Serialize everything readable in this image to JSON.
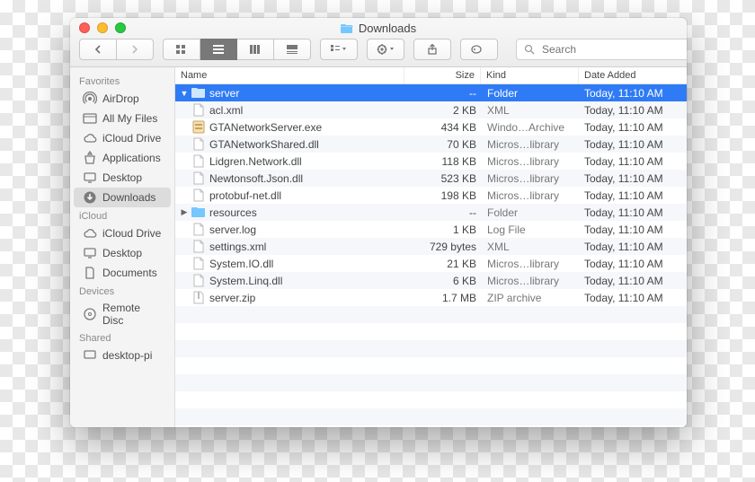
{
  "window": {
    "title": "Downloads"
  },
  "search": {
    "placeholder": "Search"
  },
  "sidebar": {
    "sections": [
      {
        "heading": "Favorites",
        "items": [
          {
            "icon": "airdrop",
            "label": "AirDrop"
          },
          {
            "icon": "allfiles",
            "label": "All My Files"
          },
          {
            "icon": "cloud",
            "label": "iCloud Drive"
          },
          {
            "icon": "apps",
            "label": "Applications"
          },
          {
            "icon": "desktop",
            "label": "Desktop"
          },
          {
            "icon": "downloads",
            "label": "Downloads",
            "selected": true
          }
        ]
      },
      {
        "heading": "iCloud",
        "items": [
          {
            "icon": "cloud",
            "label": "iCloud Drive"
          },
          {
            "icon": "desktop",
            "label": "Desktop"
          },
          {
            "icon": "docs",
            "label": "Documents"
          }
        ]
      },
      {
        "heading": "Devices",
        "items": [
          {
            "icon": "disc",
            "label": "Remote Disc"
          }
        ]
      },
      {
        "heading": "Shared",
        "items": [
          {
            "icon": "screen",
            "label": "desktop-pi"
          }
        ]
      }
    ]
  },
  "columns": {
    "name": "Name",
    "size": "Size",
    "kind": "Kind",
    "date": "Date Added"
  },
  "files": [
    {
      "level": 0,
      "disclosure": "down",
      "icon": "folder",
      "name": "server",
      "size": "--",
      "kind": "Folder",
      "date": "Today, 11:10 AM",
      "selected": true
    },
    {
      "level": 1,
      "icon": "file",
      "name": "acl.xml",
      "size": "2 KB",
      "kind": "XML",
      "date": "Today, 11:10 AM"
    },
    {
      "level": 1,
      "icon": "exe",
      "name": "GTANetworkServer.exe",
      "size": "434 KB",
      "kind": "Windo…Archive",
      "date": "Today, 11:10 AM"
    },
    {
      "level": 1,
      "icon": "file",
      "name": "GTANetworkShared.dll",
      "size": "70 KB",
      "kind": "Micros…library",
      "date": "Today, 11:10 AM"
    },
    {
      "level": 1,
      "icon": "file",
      "name": "Lidgren.Network.dll",
      "size": "118 KB",
      "kind": "Micros…library",
      "date": "Today, 11:10 AM"
    },
    {
      "level": 1,
      "icon": "file",
      "name": "Newtonsoft.Json.dll",
      "size": "523 KB",
      "kind": "Micros…library",
      "date": "Today, 11:10 AM"
    },
    {
      "level": 1,
      "icon": "file",
      "name": "protobuf-net.dll",
      "size": "198 KB",
      "kind": "Micros…library",
      "date": "Today, 11:10 AM"
    },
    {
      "level": 1,
      "disclosure": "right",
      "icon": "folder",
      "name": "resources",
      "size": "--",
      "kind": "Folder",
      "date": "Today, 11:10 AM"
    },
    {
      "level": 1,
      "icon": "file",
      "name": "server.log",
      "size": "1 KB",
      "kind": "Log File",
      "date": "Today, 11:10 AM"
    },
    {
      "level": 1,
      "icon": "file",
      "name": "settings.xml",
      "size": "729 bytes",
      "kind": "XML",
      "date": "Today, 11:10 AM"
    },
    {
      "level": 1,
      "icon": "file",
      "name": "System.IO.dll",
      "size": "21 KB",
      "kind": "Micros…library",
      "date": "Today, 11:10 AM"
    },
    {
      "level": 1,
      "icon": "file",
      "name": "System.Linq.dll",
      "size": "6 KB",
      "kind": "Micros…library",
      "date": "Today, 11:10 AM"
    },
    {
      "level": 0,
      "icon": "zip",
      "name": "server.zip",
      "size": "1.7 MB",
      "kind": "ZIP archive",
      "date": "Today, 11:10 AM"
    }
  ]
}
